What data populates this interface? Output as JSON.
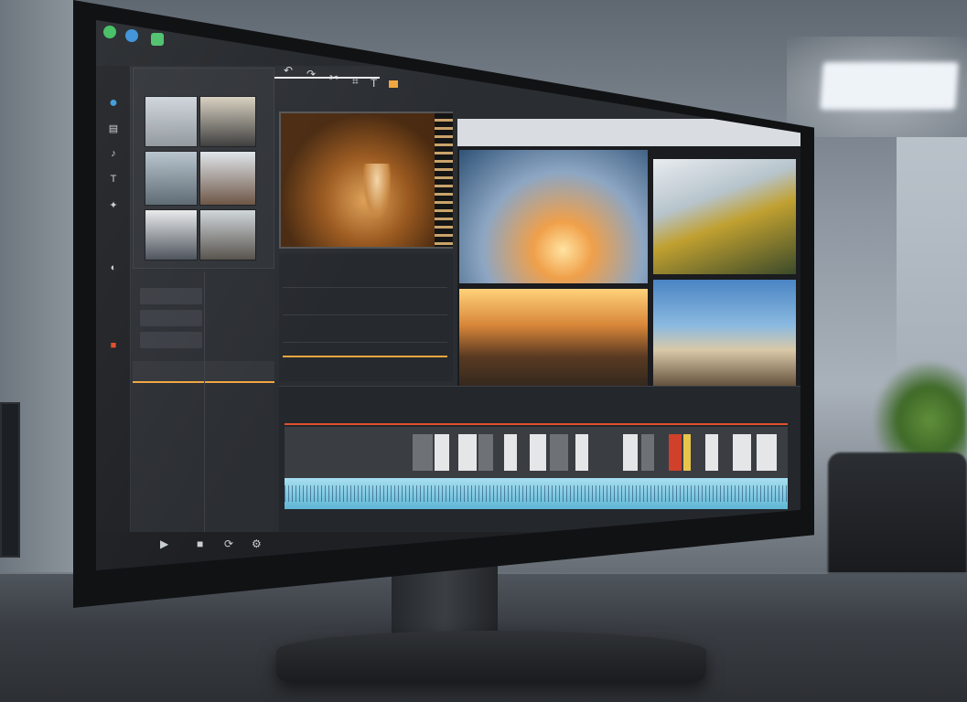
{
  "scene": "monitor-showing-video-editor",
  "colors": {
    "accent_orange": "#f0a640",
    "timeline_red": "#e0502c",
    "audio_track": "#6fc3e0",
    "screen_bg": "#2a2d32"
  },
  "icons": {
    "toolbar": [
      "undo-icon",
      "redo-icon",
      "cut-icon",
      "crop-icon",
      "text-icon",
      "color-icon"
    ],
    "rail": [
      "home-icon",
      "media-icon",
      "audio-icon",
      "titles-icon",
      "effects-icon",
      "export-icon"
    ],
    "bottom": [
      "play-icon",
      "stop-icon",
      "loop-icon",
      "settings-icon"
    ]
  }
}
